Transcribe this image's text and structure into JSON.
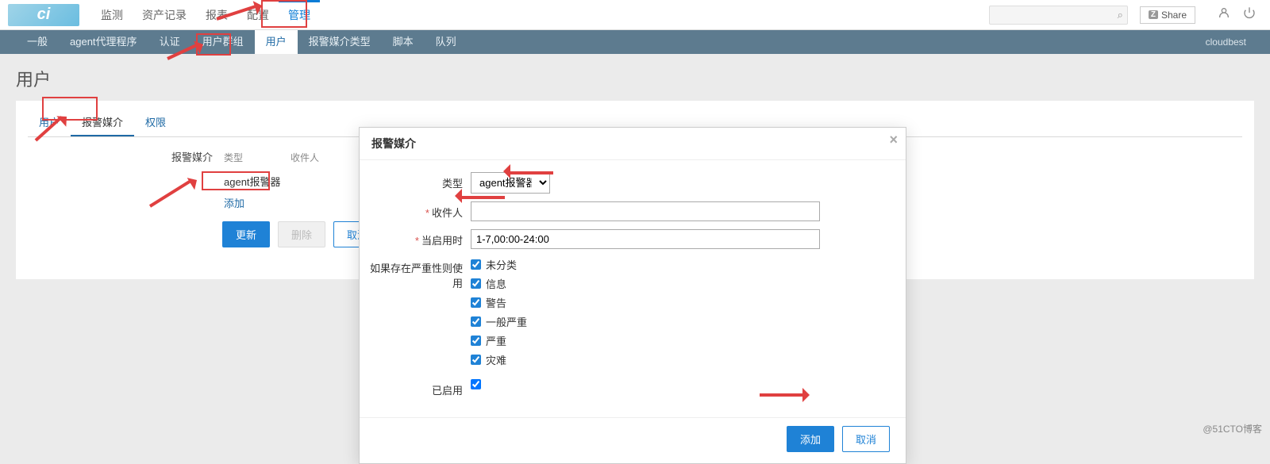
{
  "topnav": {
    "items": [
      "监测",
      "资产记录",
      "报表",
      "配置",
      "管理"
    ],
    "active_index": 4,
    "share_label": "Share"
  },
  "subnav": {
    "items": [
      "一般",
      "agent代理程序",
      "认证",
      "用户群组",
      "用户",
      "报警媒介类型",
      "脚本",
      "队列"
    ],
    "active_index": 4,
    "user_label": "cloudbest"
  },
  "page": {
    "title": "用户",
    "tabs": [
      "用户",
      "报警媒介",
      "权限"
    ],
    "active_tab": 1,
    "section_label": "报警媒介",
    "table": {
      "headers": [
        "类型",
        "收件人"
      ],
      "rows": [
        {
          "type": "agent报警器",
          "recipient": ""
        }
      ]
    },
    "add_link": "添加",
    "buttons": {
      "update": "更新",
      "delete": "删除",
      "cancel": "取消"
    }
  },
  "dialog": {
    "title": "报警媒介",
    "labels": {
      "type": "类型",
      "recipient": "收件人",
      "active_time": "当启用时",
      "severity": "如果存在严重性则使用",
      "enabled": "已启用"
    },
    "values": {
      "type": "agent报警器",
      "recipient": "",
      "active_time": "1-7,00:00-24:00",
      "enabled": true
    },
    "severity_options": [
      {
        "label": "未分类",
        "checked": true
      },
      {
        "label": "信息",
        "checked": true
      },
      {
        "label": "警告",
        "checked": true
      },
      {
        "label": "一般严重",
        "checked": true
      },
      {
        "label": "严重",
        "checked": true
      },
      {
        "label": "灾难",
        "checked": true
      }
    ],
    "buttons": {
      "add": "添加",
      "cancel": "取消"
    }
  },
  "watermark": "@51CTO博客"
}
